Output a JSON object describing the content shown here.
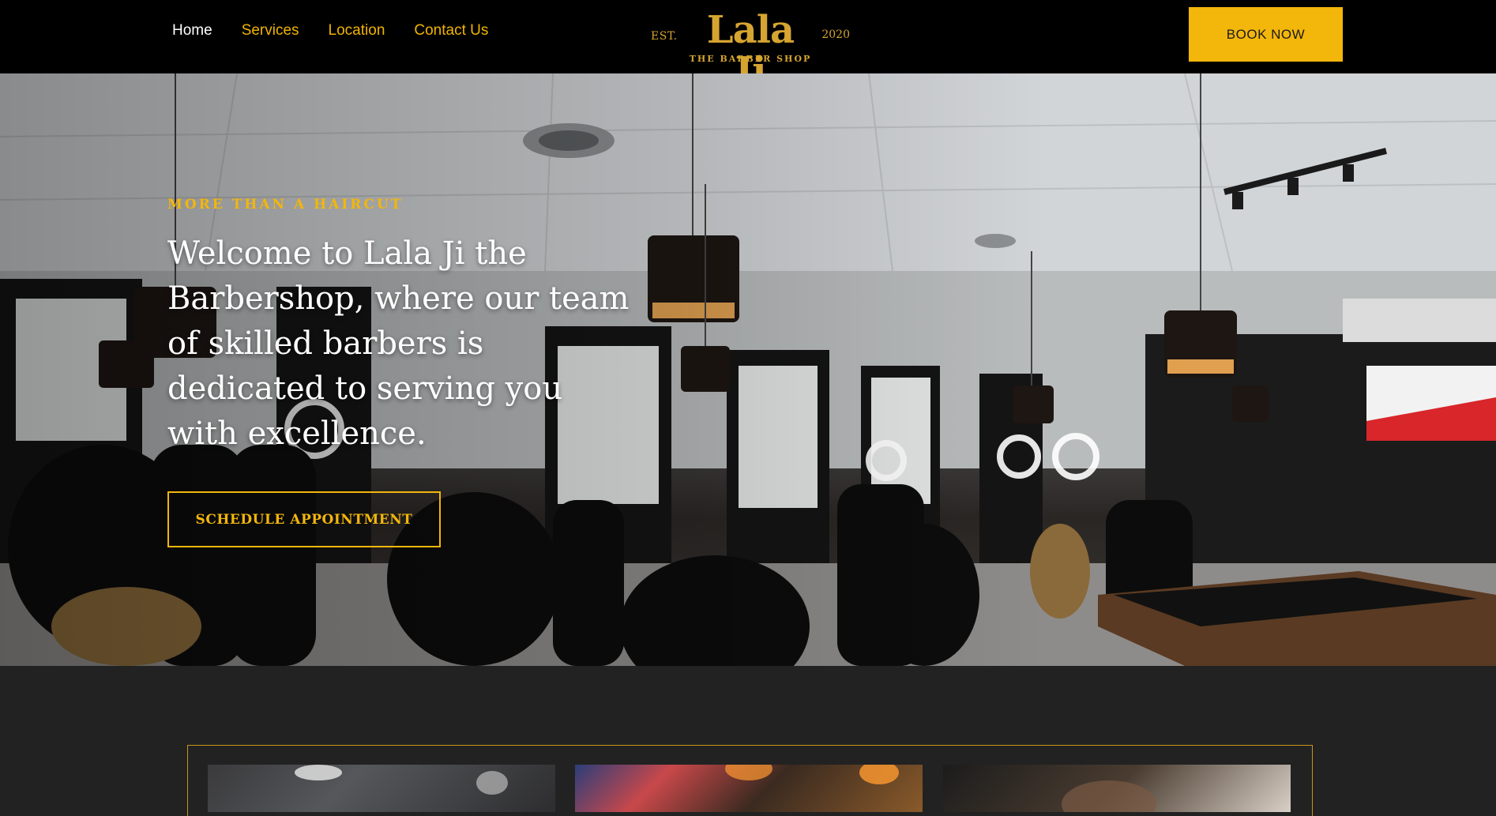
{
  "nav": {
    "items": [
      {
        "label": "Home",
        "active": true
      },
      {
        "label": "Services",
        "active": false
      },
      {
        "label": "Location",
        "active": false
      },
      {
        "label": "Contact Us",
        "active": false
      }
    ]
  },
  "logo": {
    "est": "EST.",
    "name": "Lala Ji",
    "year": "2020",
    "tagline": "THE BARBER SHOP"
  },
  "header": {
    "book_label": "BOOK NOW"
  },
  "hero": {
    "kicker": "MORE THAN A HAIRCUT",
    "title": "Welcome to Lala Ji the Barbershop, where our team of skilled barbers is dedicated to serving you with excellence.",
    "cta_label": "SCHEDULE APPOINTMENT"
  },
  "colors": {
    "accent": "#f3b60b",
    "header_bg": "#000000",
    "section_bg": "#222222",
    "logo_gold": "#d6a531"
  }
}
